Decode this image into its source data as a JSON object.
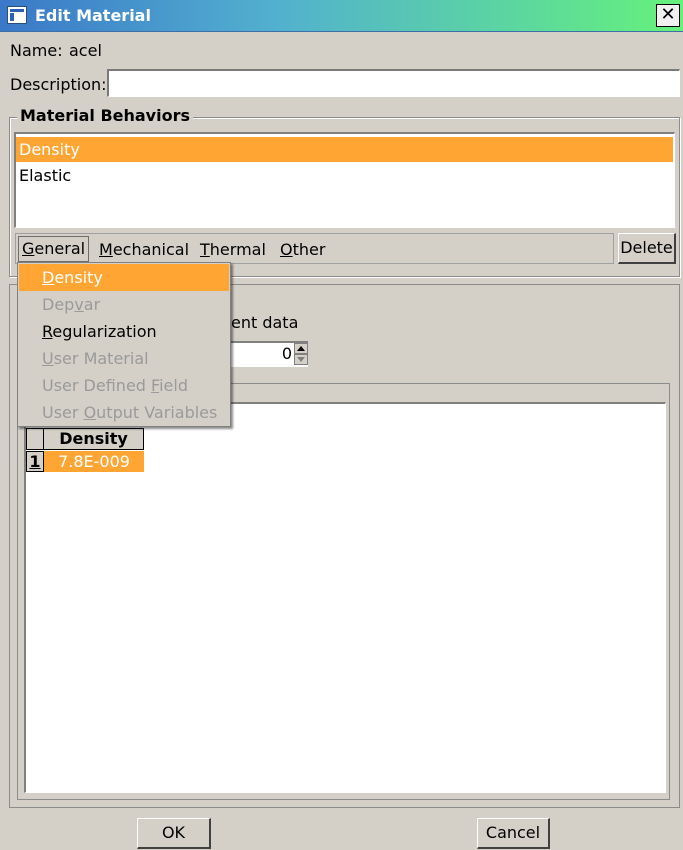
{
  "window": {
    "title": "Edit Material",
    "close_glyph": "✕"
  },
  "name_row": {
    "label": "Name:",
    "value": "acel"
  },
  "description": {
    "label": "Description:",
    "value": ""
  },
  "material_behaviors": {
    "title": "Material Behaviors",
    "items": [
      {
        "label": "Density",
        "selected": true
      },
      {
        "label": "Elastic",
        "selected": false
      }
    ]
  },
  "menu": {
    "general": {
      "ul": "G",
      "rest": "eneral"
    },
    "mechanical": {
      "ul": "M",
      "rest": "echanical"
    },
    "thermal": {
      "ul": "T",
      "rest": "hermal"
    },
    "other": {
      "ul": "O",
      "rest": "ther"
    },
    "delete_label": "Delete"
  },
  "dropdown": {
    "items": [
      {
        "pre": "",
        "ul": "D",
        "post": "ensity",
        "state": "highlighted"
      },
      {
        "pre": "Dep",
        "ul": "v",
        "post": "ar",
        "state": "disabled"
      },
      {
        "pre": "",
        "ul": "R",
        "post": "egularization",
        "state": "enabled"
      },
      {
        "pre": "",
        "ul": "U",
        "post": "ser Material",
        "state": "disabled"
      },
      {
        "pre": "User Defined ",
        "ul": "F",
        "post": "ield",
        "state": "disabled"
      },
      {
        "pre": "User ",
        "ul": "O",
        "post": "utput Variables",
        "state": "disabled"
      }
    ]
  },
  "behind_dropdown": {
    "partial_text": "ent data",
    "spinner_value": "0"
  },
  "table": {
    "columns": [
      "Density"
    ],
    "rows": [
      {
        "num": "1",
        "values": [
          "7.8E-009"
        ]
      }
    ]
  },
  "buttons": {
    "ok": "OK",
    "cancel": "Cancel"
  },
  "colors": {
    "selection": "#ffa534",
    "dialog_bg": "#d4d0c8",
    "title_gradient_start": "#3a78c8",
    "title_gradient_end": "#66f27a"
  }
}
